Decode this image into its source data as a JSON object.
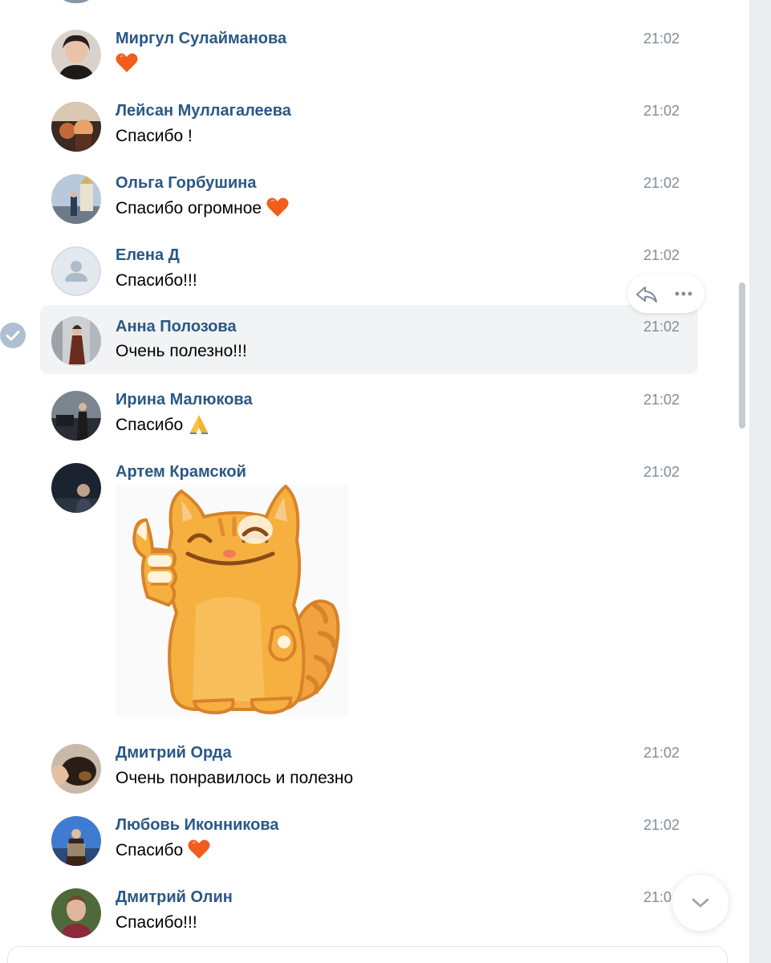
{
  "colors": {
    "name_link": "#2a5885",
    "time": "#818c99",
    "selected_bg": "#f2f3f5",
    "check_bg": "#aebfd3",
    "heart": "#f25c1d"
  },
  "messages": [
    {
      "name": "Миргул Сулайманова",
      "time": "21:02",
      "text": "",
      "emoji": "orange-heart"
    },
    {
      "name": "Лейсан Муллагалеева",
      "time": "21:02",
      "text": "Спасибо !",
      "emoji": ""
    },
    {
      "name": "Ольга Горбушина",
      "time": "21:02",
      "text": "Спасибо огромное",
      "emoji": "orange-heart"
    },
    {
      "name": "Елена Д",
      "time": "21:02",
      "text": "Спасибо!!!",
      "emoji": ""
    },
    {
      "name": "Анна Полозова",
      "time": "21:02",
      "text": "Очень полезно!!!",
      "emoji": "",
      "selected": true
    },
    {
      "name": "Ирина Малюкова",
      "time": "21:02",
      "text": "Спасибо",
      "emoji": "folded-hands"
    },
    {
      "name": "Артем Крамской",
      "time": "21:02",
      "text": "",
      "emoji": "",
      "sticker": "cat-thumbs-up-sticker"
    },
    {
      "name": "Дмитрий Орда",
      "time": "21:02",
      "text": "Очень понравилось и полезно",
      "emoji": ""
    },
    {
      "name": "Любовь Иконникова",
      "time": "21:02",
      "text": "Спасибо",
      "emoji": "orange-heart"
    },
    {
      "name": "Дмитрий Олин",
      "time": "21:0",
      "text": "Спасибо!!!",
      "emoji": ""
    }
  ],
  "actions": {
    "reply_icon": "reply-icon",
    "more_icon": "more-icon",
    "scroll_down_icon": "chevron-down-icon"
  }
}
